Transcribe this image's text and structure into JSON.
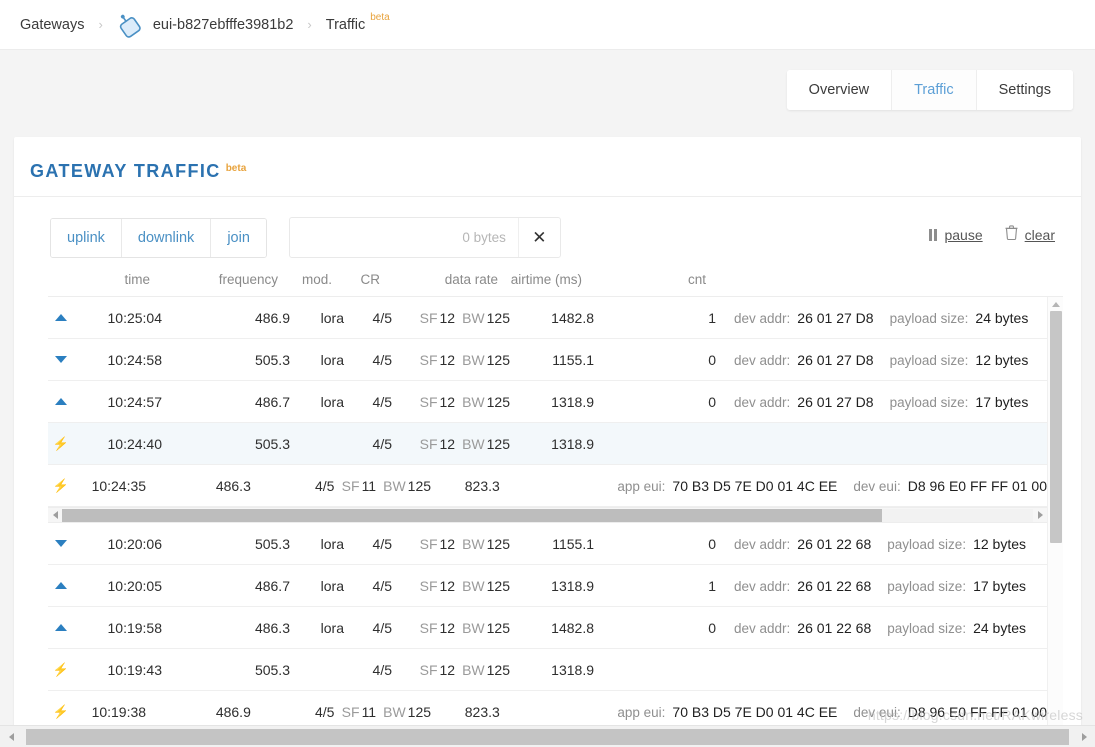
{
  "breadcrumb": {
    "root": "Gateways",
    "separator": "›",
    "gateway_id": "eui-b827ebfffe3981b2",
    "section": "Traffic",
    "beta": "beta",
    "gateway_icon": "gateway-icon"
  },
  "tabs": [
    {
      "label": "Overview",
      "active": false
    },
    {
      "label": "Traffic",
      "active": true
    },
    {
      "label": "Settings",
      "active": false
    }
  ],
  "card": {
    "title": "GATEWAY TRAFFIC",
    "beta": "beta"
  },
  "toolbar": {
    "filters": [
      "uplink",
      "downlink",
      "join"
    ],
    "search_value": "",
    "search_placeholder": "0 bytes",
    "clear_icon": "✕",
    "pause_label": "pause",
    "clear_label": "clear",
    "trash_icon": "trash-icon",
    "pause_icon": "pause-icon"
  },
  "table": {
    "headers": {
      "time": "time",
      "frequency": "frequency",
      "mod": "mod.",
      "cr": "CR",
      "data_rate": "data rate",
      "airtime": "airtime (ms)",
      "cnt": "cnt"
    },
    "labels": {
      "sf": "SF",
      "bw": "BW",
      "dev_addr": "dev addr:",
      "payload_size": "payload size:",
      "app_eui": "app eui:",
      "dev_eui": "dev eui:"
    },
    "rows": [
      {
        "kind": "uplink",
        "icon": "triangle-up-icon",
        "time": "10:25:04",
        "frequency": "486.9",
        "mod": "lora",
        "cr": "4/5",
        "sf": "12",
        "bw": "125",
        "airtime": "1482.8",
        "cnt": "1",
        "dev_addr": "26 01 27 D8",
        "payload_size": "24 bytes",
        "highlight": false
      },
      {
        "kind": "downlink",
        "icon": "triangle-down-icon",
        "time": "10:24:58",
        "frequency": "505.3",
        "mod": "lora",
        "cr": "4/5",
        "sf": "12",
        "bw": "125",
        "airtime": "1155.1",
        "cnt": "0",
        "dev_addr": "26 01 27 D8",
        "payload_size": "12 bytes",
        "highlight": false
      },
      {
        "kind": "uplink",
        "icon": "triangle-up-icon",
        "time": "10:24:57",
        "frequency": "486.7",
        "mod": "lora",
        "cr": "4/5",
        "sf": "12",
        "bw": "125",
        "airtime": "1318.9",
        "cnt": "0",
        "dev_addr": "26 01 27 D8",
        "payload_size": "17 bytes",
        "highlight": false
      },
      {
        "kind": "join-accept",
        "icon": "bolt-green-icon",
        "time": "10:24:40",
        "frequency": "505.3",
        "mod": "",
        "cr": "4/5",
        "sf": "12",
        "bw": "125",
        "airtime": "1318.9",
        "cnt": "",
        "highlight": true
      },
      {
        "kind": "join-request",
        "icon": "bolt-yellow-icon",
        "time": "10:24:35",
        "frequency": "486.3",
        "mod": "",
        "cr": "4/5",
        "sf": "11",
        "bw": "125",
        "airtime": "823.3",
        "cnt": "",
        "app_eui": "70 B3 D5 7E D0 01 4C EE",
        "dev_eui": "D8 96 E0 FF FF 01 00",
        "highlight": false
      },
      {
        "kind": "downlink",
        "icon": "triangle-down-icon",
        "time": "10:20:06",
        "frequency": "505.3",
        "mod": "lora",
        "cr": "4/5",
        "sf": "12",
        "bw": "125",
        "airtime": "1155.1",
        "cnt": "0",
        "dev_addr": "26 01 22 68",
        "payload_size": "12 bytes",
        "highlight": false
      },
      {
        "kind": "uplink",
        "icon": "triangle-up-icon",
        "time": "10:20:05",
        "frequency": "486.7",
        "mod": "lora",
        "cr": "4/5",
        "sf": "12",
        "bw": "125",
        "airtime": "1318.9",
        "cnt": "1",
        "dev_addr": "26 01 22 68",
        "payload_size": "17 bytes",
        "highlight": false
      },
      {
        "kind": "uplink",
        "icon": "triangle-up-icon",
        "time": "10:19:58",
        "frequency": "486.3",
        "mod": "lora",
        "cr": "4/5",
        "sf": "12",
        "bw": "125",
        "airtime": "1482.8",
        "cnt": "0",
        "dev_addr": "26 01 22 68",
        "payload_size": "24 bytes",
        "highlight": false
      },
      {
        "kind": "join-accept",
        "icon": "bolt-green-icon",
        "time": "10:19:43",
        "frequency": "505.3",
        "mod": "",
        "cr": "4/5",
        "sf": "12",
        "bw": "125",
        "airtime": "1318.9",
        "cnt": "",
        "highlight": false
      },
      {
        "kind": "join-request",
        "icon": "bolt-yellow-icon",
        "time": "10:19:38",
        "frequency": "486.9",
        "mod": "",
        "cr": "4/5",
        "sf": "11",
        "bw": "125",
        "airtime": "823.3",
        "cnt": "",
        "app_eui": "70 B3 D5 7E D0 01 4C EE",
        "dev_eui": "D8 96 E0 FF FF 01 00",
        "highlight": false
      }
    ],
    "scroll_divider_after_index": 4
  },
  "watermark": "https://blog.csdn.net/RAKwireless"
}
